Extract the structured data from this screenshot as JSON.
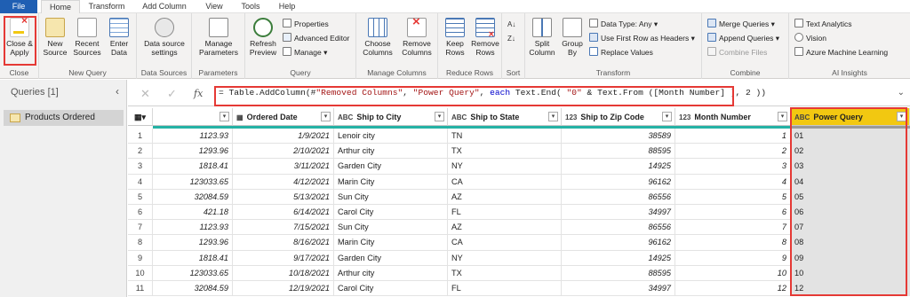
{
  "tabs": [
    "File",
    "Home",
    "Transform",
    "Add Column",
    "View",
    "Tools",
    "Help"
  ],
  "ribbon": {
    "close": {
      "close_apply": "Close &",
      "close_apply2": "Apply",
      "label": "Close"
    },
    "new_query": {
      "new_source": "New",
      "new_source2": "Source",
      "recent_sources": "Recent",
      "recent_sources2": "Sources",
      "enter_data": "Enter",
      "enter_data2": "Data",
      "label": "New Query"
    },
    "data_sources": {
      "settings": "Data source",
      "settings2": "settings",
      "label": "Data Sources"
    },
    "parameters": {
      "manage": "Manage",
      "manage2": "Parameters",
      "label": "Parameters"
    },
    "query": {
      "refresh": "Refresh",
      "refresh2": "Preview",
      "properties": "Properties",
      "advanced_editor": "Advanced Editor",
      "manage": "Manage",
      "label": "Query"
    },
    "manage_columns": {
      "choose": "Choose",
      "choose2": "Columns",
      "remove": "Remove",
      "remove2": "Columns",
      "label": "Manage Columns"
    },
    "reduce_rows": {
      "keep": "Keep",
      "keep2": "Rows",
      "remove": "Remove",
      "remove2": "Rows",
      "label": "Reduce Rows"
    },
    "sort": {
      "label": "Sort"
    },
    "transform": {
      "split": "Split",
      "split2": "Column",
      "group": "Group",
      "group2": "By",
      "data_type": "Data Type: Any",
      "first_row": "Use First Row as Headers",
      "replace": "Replace Values",
      "label": "Transform"
    },
    "combine": {
      "merge": "Merge Queries",
      "append": "Append Queries",
      "combine_files": "Combine Files",
      "label": "Combine"
    },
    "ai": {
      "text_analytics": "Text Analytics",
      "vision": "Vision",
      "azure_ml": "Azure Machine Learning",
      "label": "AI Insights"
    }
  },
  "queries": {
    "title": "Queries [1]",
    "items": [
      "Products Ordered"
    ]
  },
  "formula": {
    "fx": "fx",
    "p1": "= Table.AddColumn(#",
    "s1": "\"Removed Columns\"",
    "p2": ", ",
    "s2": "\"Power Query\"",
    "p3": ", ",
    "kw": "each",
    "p4": " Text.End( ",
    "s3": "\"0\"",
    "p5": " & Text.From ([Month Number] ), 2 ))"
  },
  "columns": [
    {
      "name": "",
      "type": ""
    },
    {
      "name": "Ordered Date",
      "type": "▦"
    },
    {
      "name": "Ship to City",
      "type": "ABC"
    },
    {
      "name": "Ship to State",
      "type": "ABC"
    },
    {
      "name": "Ship to Zip Code",
      "type": "123"
    },
    {
      "name": "Month Number",
      "type": "123"
    },
    {
      "name": "Power Query",
      "type": "ABC"
    }
  ],
  "rows": [
    [
      "1",
      "1123.93",
      "1/9/2021",
      "Lenoir city",
      "TN",
      "38589",
      "1",
      "01"
    ],
    [
      "2",
      "1293.96",
      "2/10/2021",
      "Arthur city",
      "TX",
      "88595",
      "2",
      "02"
    ],
    [
      "3",
      "1818.41",
      "3/11/2021",
      "Garden City",
      "NY",
      "14925",
      "3",
      "03"
    ],
    [
      "4",
      "123033.65",
      "4/12/2021",
      "Marin City",
      "CA",
      "96162",
      "4",
      "04"
    ],
    [
      "5",
      "32084.59",
      "5/13/2021",
      "Sun City",
      "AZ",
      "86556",
      "5",
      "05"
    ],
    [
      "6",
      "421.18",
      "6/14/2021",
      "Carol City",
      "FL",
      "34997",
      "6",
      "06"
    ],
    [
      "7",
      "1123.93",
      "7/15/2021",
      "Sun City",
      "AZ",
      "86556",
      "7",
      "07"
    ],
    [
      "8",
      "1293.96",
      "8/16/2021",
      "Marin City",
      "CA",
      "96162",
      "8",
      "08"
    ],
    [
      "9",
      "1818.41",
      "9/17/2021",
      "Garden City",
      "NY",
      "14925",
      "9",
      "09"
    ],
    [
      "10",
      "123033.65",
      "10/18/2021",
      "Arthur city",
      "TX",
      "88595",
      "10",
      "10"
    ],
    [
      "11",
      "32084.59",
      "12/19/2021",
      "Carol City",
      "FL",
      "34997",
      "12",
      "12"
    ]
  ]
}
